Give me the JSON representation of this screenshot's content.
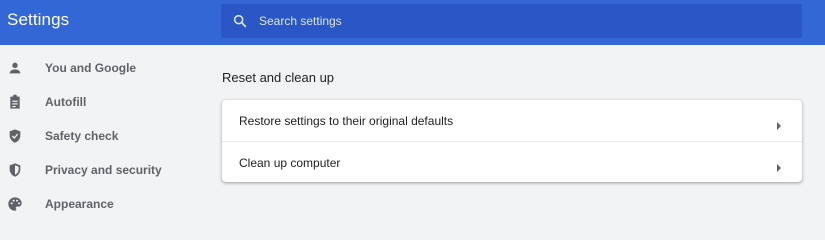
{
  "header": {
    "title": "Settings",
    "search_placeholder": "Search settings",
    "search_value": ""
  },
  "sidebar": {
    "items": [
      {
        "label": "You and Google",
        "icon": "person-icon"
      },
      {
        "label": "Autofill",
        "icon": "clipboard-icon"
      },
      {
        "label": "Safety check",
        "icon": "shield-check-icon"
      },
      {
        "label": "Privacy and security",
        "icon": "shield-half-icon"
      },
      {
        "label": "Appearance",
        "icon": "palette-icon"
      }
    ]
  },
  "main": {
    "section_title": "Reset and clean up",
    "rows": [
      {
        "label": "Restore settings to their original defaults"
      },
      {
        "label": "Clean up computer"
      }
    ]
  },
  "colors": {
    "header_bg": "#3367d6",
    "search_bg": "#2a56c6",
    "page_bg": "#f1f3f4",
    "icon_gray": "#5f6368"
  }
}
